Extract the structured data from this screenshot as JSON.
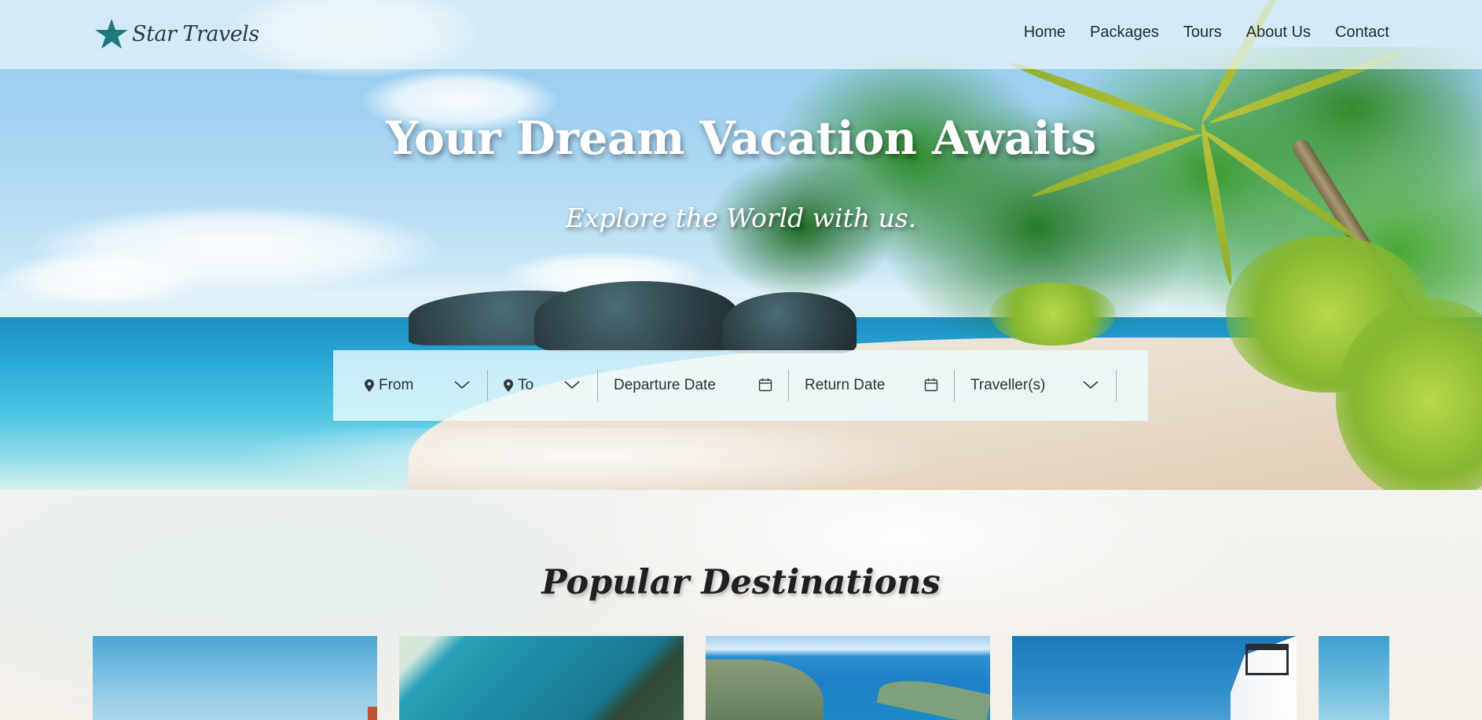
{
  "brand": {
    "name": "Star Travels",
    "accent_color": "#1e7a7c",
    "logo_icon": "star-icon"
  },
  "nav": {
    "links": [
      "Home",
      "Packages",
      "Tours",
      "About Us",
      "Contact"
    ]
  },
  "hero": {
    "title": "Your Dream Vacation Awaits",
    "subtitle": "Explore the World with us."
  },
  "search": {
    "from_label": "From",
    "to_label": "To",
    "departure_label": "Departure Date",
    "return_label": "Return Date",
    "travellers_label": "Traveller(s)",
    "icons": {
      "location": "map-pin-icon",
      "dropdown": "chevron-down-icon",
      "date": "calendar-icon"
    }
  },
  "popular": {
    "title": "Popular Destinations"
  }
}
